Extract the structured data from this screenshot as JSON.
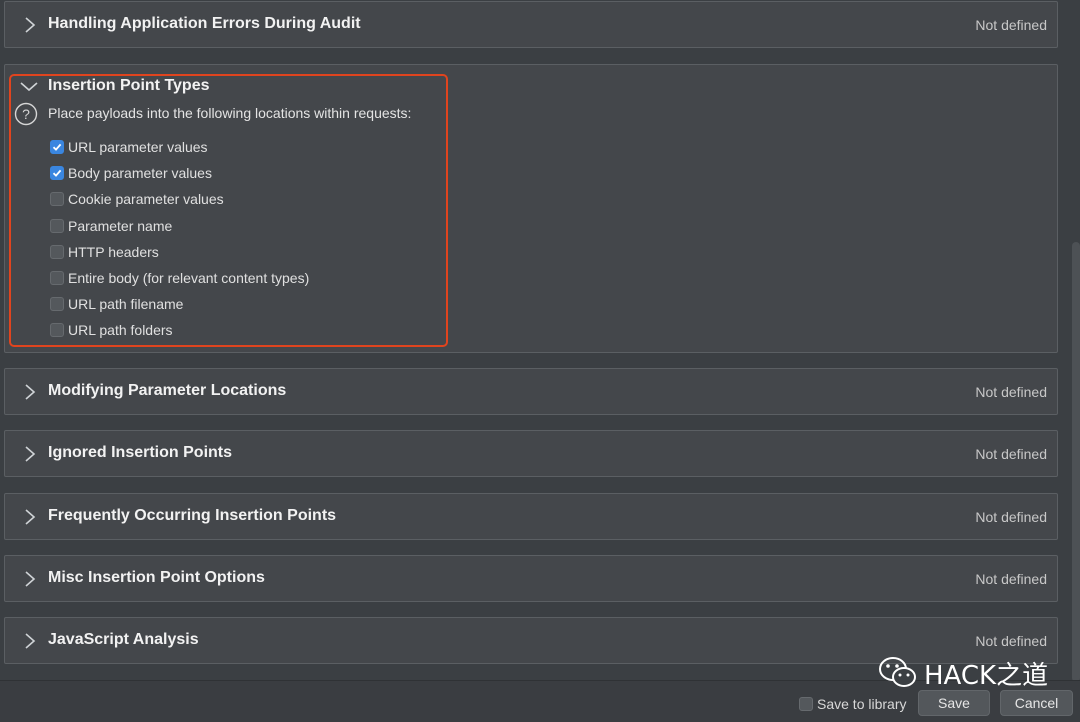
{
  "sections_top": {
    "title": "Handling Application Errors During Audit",
    "status": "Not defined"
  },
  "insertion_point_types": {
    "title": "Insertion Point Types",
    "description": "Place payloads into the following locations within requests:",
    "options": [
      {
        "label": "URL parameter values",
        "checked": true
      },
      {
        "label": "Body parameter values",
        "checked": true
      },
      {
        "label": "Cookie parameter values",
        "checked": false
      },
      {
        "label": "Parameter name",
        "checked": false
      },
      {
        "label": "HTTP headers",
        "checked": false
      },
      {
        "label": "Entire body (for relevant content types)",
        "checked": false
      },
      {
        "label": "URL path filename",
        "checked": false
      },
      {
        "label": "URL path folders",
        "checked": false
      }
    ]
  },
  "sections": [
    {
      "title": "Modifying Parameter Locations",
      "status": "Not defined"
    },
    {
      "title": "Ignored Insertion Points",
      "status": "Not defined"
    },
    {
      "title": "Frequently Occurring Insertion Points",
      "status": "Not defined"
    },
    {
      "title": "Misc Insertion Point Options",
      "status": "Not defined"
    },
    {
      "title": "JavaScript Analysis",
      "status": "Not defined"
    }
  ],
  "footer": {
    "save_to_library_label": "Save to library",
    "save_to_library_checked": false,
    "save_label": "Save",
    "cancel_label": "Cancel"
  },
  "watermark": {
    "text": "HACK之道"
  },
  "colors": {
    "highlight_border": "#e0441e",
    "checkbox_checked": "#3a86e0",
    "panel_bg": "#44474b",
    "page_bg": "#3b3f43"
  }
}
